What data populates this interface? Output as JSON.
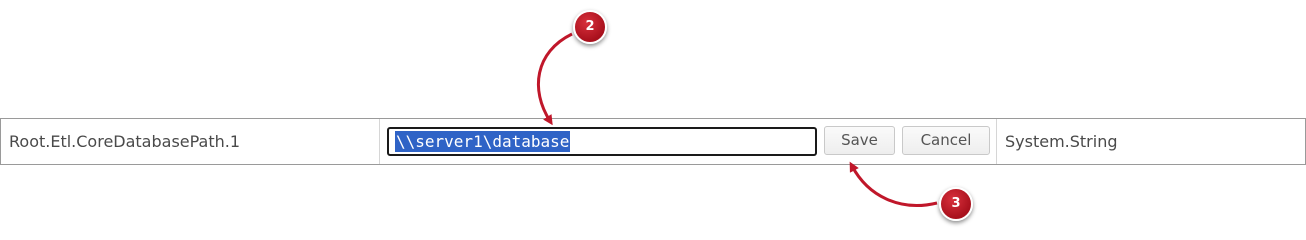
{
  "row": {
    "key": "Root.Etl.CoreDatabasePath.1",
    "value": "\\\\server1\\database",
    "save_label": "Save",
    "cancel_label": "Cancel",
    "type": "System.String"
  },
  "annotations": {
    "marker_2": "2",
    "marker_3": "3",
    "marker_color": "#c0172a"
  }
}
